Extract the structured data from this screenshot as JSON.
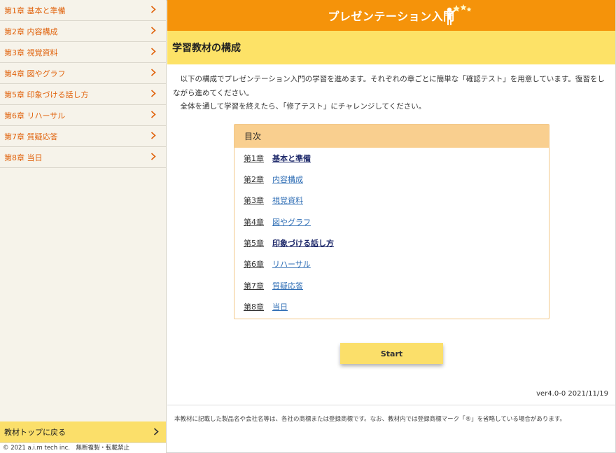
{
  "sidebar": {
    "items": [
      {
        "label": "第1章 基本と準備"
      },
      {
        "label": "第2章 内容構成"
      },
      {
        "label": "第3章 視覚資料"
      },
      {
        "label": "第4章 図やグラフ"
      },
      {
        "label": "第5章 印象づける話し方"
      },
      {
        "label": "第6章 リハーサル"
      },
      {
        "label": "第7章 質疑応答"
      },
      {
        "label": "第8章 当日"
      }
    ],
    "bottom_link": "教材トップに戻る",
    "copyright": "© 2021 a.i.m tech inc.　無断複製・転載禁止"
  },
  "header": {
    "title": "プレゼンテーション入門",
    "logo_icon": "person-with-stars-icon"
  },
  "page": {
    "heading": "学習教材の構成",
    "intro_line1": "以下の構成でプレゼンテーション入門の学習を進めます。それぞれの章ごとに簡単な「確認テスト」を用意しています。復習をしながら進めてください。",
    "intro_line2": "全体を通して学習を終えたら、「修了テスト」にチャレンジしてください。"
  },
  "toc": {
    "heading": "目次",
    "rows": [
      {
        "num": "第1章",
        "title": "基本と準備",
        "state": "visited"
      },
      {
        "num": "第2章",
        "title": "内容構成",
        "state": "link"
      },
      {
        "num": "第3章",
        "title": "視覚資料",
        "state": "link"
      },
      {
        "num": "第4章",
        "title": "図やグラフ",
        "state": "link"
      },
      {
        "num": "第5章",
        "title": "印象づける話し方",
        "state": "visited"
      },
      {
        "num": "第6章",
        "title": "リハーサル",
        "state": "link"
      },
      {
        "num": "第7章",
        "title": "質疑応答",
        "state": "link"
      },
      {
        "num": "第8章",
        "title": "当日",
        "state": "link"
      }
    ]
  },
  "start_button": "Start",
  "version": "ver4.0-0 2021/11/19",
  "notice": "本教材に記載した製品名や会社名等は、各社の商標または登録商標です。なお、教材内では登録商標マーク「®」を省略している場合があります。",
  "colors": {
    "header": "#f5930a",
    "subheader": "#fde267",
    "accent_text": "#e0620b",
    "toc_head": "#f9cf8f",
    "button": "#fbdf6a",
    "link": "#2f6eb5",
    "visited": "#1f2a6b"
  }
}
